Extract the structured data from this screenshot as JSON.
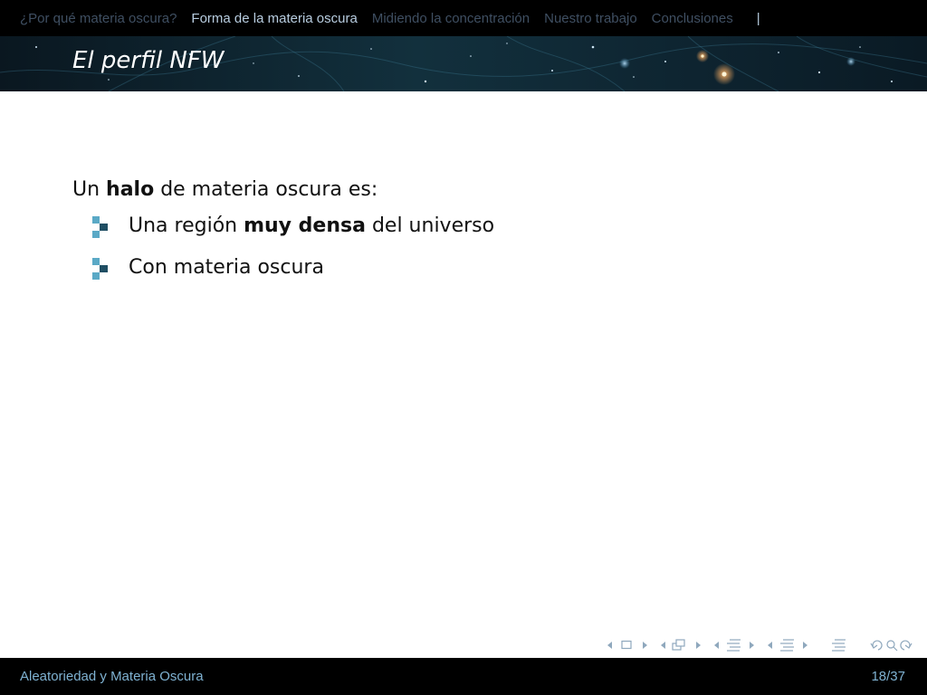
{
  "nav": {
    "sections": [
      {
        "label": "¿Por qué materia oscura?",
        "active": false
      },
      {
        "label": "Forma de la materia oscura",
        "active": true
      },
      {
        "label": "Midiendo la concentración",
        "active": false
      },
      {
        "label": "Nuestro trabajo",
        "active": false
      },
      {
        "label": "Conclusiones",
        "active": false
      }
    ],
    "separator": "|"
  },
  "frame": {
    "title": "El perfil NFW"
  },
  "content": {
    "intro_prefix": "Un ",
    "intro_bold": "halo",
    "intro_suffix": " de materia oscura es:",
    "bullets": [
      {
        "prefix": "Una región ",
        "bold": "muy densa",
        "suffix": " del universo"
      },
      {
        "prefix": "Con materia oscura",
        "bold": "",
        "suffix": ""
      }
    ]
  },
  "footer": {
    "title": "Aleatoriedad y Materia Oscura",
    "page": "18/37"
  },
  "colors": {
    "nav_active": "#b8cde0",
    "nav_inactive": "#3f4f62",
    "footer_text": "#7fb2d2",
    "bullet_light": "#5aa9c6",
    "bullet_dark": "#1f4e63",
    "navsym": "#8fa8bd"
  },
  "icons": {
    "bullet": "square-step-bullet-icon",
    "nav_symbols": [
      "prev-arrow",
      "frame-icon",
      "next-arrow",
      "prev-arrow",
      "subsection-icon",
      "next-arrow",
      "prev-arrow",
      "section-icon",
      "next-arrow",
      "prev-arrow",
      "presentation-icon",
      "next-arrow",
      "appendix-icon",
      "back-icon",
      "search-icon",
      "forward-icon"
    ]
  }
}
